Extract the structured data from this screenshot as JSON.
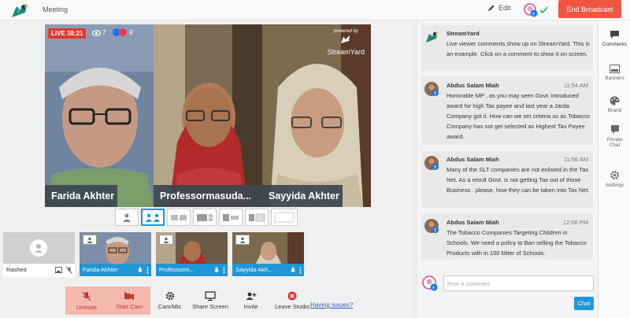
{
  "header": {
    "title": "Meeting",
    "edit_label": "Edit",
    "end_label": "End Broadcast"
  },
  "stage": {
    "live_label": "LIVE 38:21",
    "viewer_count": "7",
    "reaction_count": "9",
    "watermark_powered": "powered by",
    "watermark_brand": "StreamYard",
    "participants": [
      {
        "name": "Farida Akhter"
      },
      {
        "name": "Professormasuda..."
      },
      {
        "name": "Sayyida Akhter"
      }
    ]
  },
  "backstage": [
    {
      "name": "Rashed",
      "on_stage": false
    },
    {
      "name": "Farida Akhter",
      "on_stage": true
    },
    {
      "name": "Professorm...",
      "on_stage": true
    },
    {
      "name": "Sayyida Akh...",
      "on_stage": true
    }
  ],
  "toolbar": {
    "items": [
      {
        "label": "Unmute",
        "icon": "mic-off-icon"
      },
      {
        "label": "Start Cam",
        "icon": "camera-off-icon"
      },
      {
        "label": "Cam/Mic",
        "icon": "gear-icon"
      },
      {
        "label": "Share Screen",
        "icon": "monitor-icon"
      },
      {
        "label": "Invite",
        "icon": "add-user-icon"
      },
      {
        "label": "Leave Studio",
        "icon": "close-circle-icon"
      }
    ],
    "issues_label": "Having issues?"
  },
  "chat": {
    "messages": [
      {
        "author": "StreamYard",
        "time": "",
        "text": "Live viewer comments show up on StreamYard. This is an example. Click on a comment to show it on screen."
      },
      {
        "author": "Abdus Salam Miah",
        "time": "11:54 AM",
        "text": "Honorable MP , as you may seen Govt. introduced award for high Tax payee and last year a Jarda Company got it. How can we set criteria so as Tobacco Company has not get selected as Highest Tax Payee award."
      },
      {
        "author": "Abdus Salam Miah",
        "time": "11:56 AM",
        "text": "Many of the SLT companies are not enlisted in the Tax Net. As a result Govt. is not getting Tax out of those Business . please, how they can be taken into Tax Net."
      },
      {
        "author": "Abdus Salam Miah",
        "time": "12:06 PM",
        "text": "The Tobacco Companies Targeting Children in Schools. We need a policy to Ban selling the Tobacco Products with in 100 Miter of Schools."
      }
    ],
    "placeholder": "Post a comment",
    "send_label": "Chat"
  },
  "rail": {
    "items": [
      {
        "label": "Comments",
        "icon": "comment-icon"
      },
      {
        "label": "Banners",
        "icon": "banner-icon"
      },
      {
        "label": "Brand",
        "icon": "palette-icon"
      },
      {
        "label": "Private Chat",
        "icon": "private-chat-icon"
      },
      {
        "label": "Settings",
        "icon": "gear-icon"
      }
    ]
  },
  "colors": {
    "accent": "#2196d6",
    "end_button": "#f0553f",
    "live_badge": "#e0392c",
    "muted_button": "#f4b9ae"
  }
}
